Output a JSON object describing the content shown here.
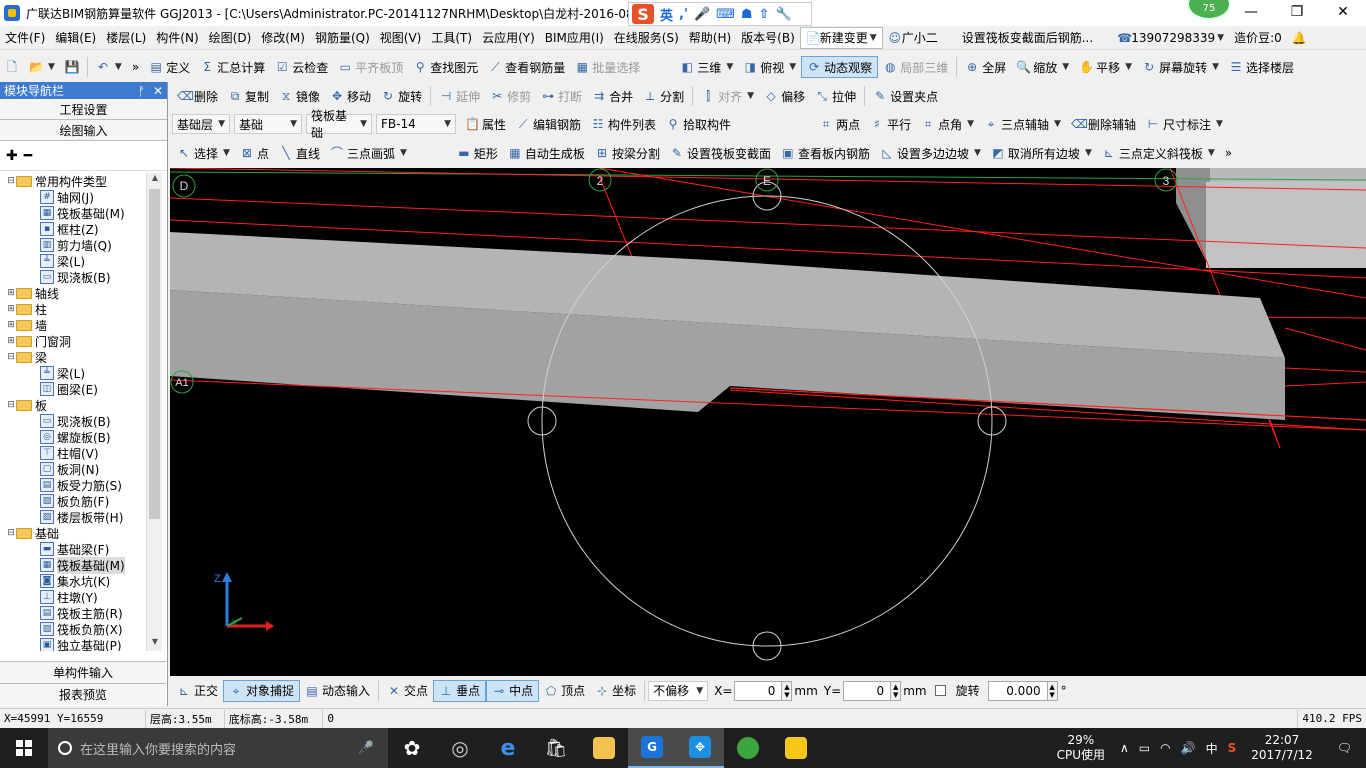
{
  "window": {
    "title": "广联达BIM钢筋算量软件 GGJ2013 - [C:\\Users\\Administrator.PC-20141127NRHM\\Desktop\\白龙村-2016-08-",
    "ime_label": "英",
    "badge": "75",
    "minimize": "—",
    "restore": "❐",
    "close": "✕"
  },
  "menu": {
    "items": [
      "文件(F)",
      "编辑(E)",
      "楼层(L)",
      "构件(N)",
      "绘图(D)",
      "修改(M)",
      "钢筋量(Q)",
      "视图(V)",
      "工具(T)",
      "云应用(Y)",
      "BIM应用(I)",
      "在线服务(S)",
      "帮助(H)",
      "版本号(B)"
    ],
    "new_change": "新建变更",
    "assistant": "广小二",
    "hint": "设置筏板变截面后钢筋...",
    "phone": "13907298339",
    "cost_beans": "造价豆:0"
  },
  "toolbar1": {
    "define": "定义",
    "summary": "汇总计算",
    "cloud_check": "云检查",
    "flush_top": "平齐板顶",
    "find_element": "查找图元",
    "view_rebar": "查看钢筋量",
    "batch_select": "批量选择",
    "view3d": "三维",
    "top_view": "俯视",
    "dynamic_observe": "动态观察",
    "local3d": "局部三维",
    "fullscreen": "全屏",
    "zoom": "缩放",
    "pan": "平移",
    "screen_rotate": "屏幕旋转",
    "select_floor": "选择楼层"
  },
  "toolbar2": {
    "delete": "删除",
    "copy": "复制",
    "mirror": "镜像",
    "move": "移动",
    "rotate": "旋转",
    "extend": "延伸",
    "trim": "修剪",
    "break": "打断",
    "merge": "合并",
    "split": "分割",
    "align": "对齐",
    "offset": "偏移",
    "stretch": "拉伸",
    "set_grip": "设置夹点"
  },
  "toolbar3": {
    "floor": "基础层",
    "category": "基础",
    "type": "筏板基础",
    "element": "FB-14",
    "attributes": "属性",
    "edit_rebar": "编辑钢筋",
    "element_list": "构件列表",
    "pick_element": "拾取构件",
    "two_points": "两点",
    "parallel": "平行",
    "point_angle": "点角",
    "three_point_aux": "三点辅轴",
    "delete_aux": "删除辅轴",
    "dimension": "尺寸标注"
  },
  "toolbar4": {
    "select": "选择",
    "point": "点",
    "line": "直线",
    "three_point_arc": "三点画弧",
    "rectangle": "矩形",
    "auto_generate": "自动生成板",
    "split_by_beam": "按梁分割",
    "set_variable_section": "设置筏板变截面",
    "view_inner_rebar": "查看板内钢筋",
    "set_multi_slope": "设置多边边坡",
    "cancel_all_slope": "取消所有边坡",
    "three_point_slope": "三点定义斜筏板"
  },
  "nav": {
    "title": "模块导航栏",
    "pin": "ᚡ",
    "close": "✕",
    "project_settings": "工程设置",
    "drawing_input": "绘图输入",
    "single_input": "单构件输入",
    "report_preview": "报表预览",
    "tree": [
      {
        "level": 0,
        "exp": "⊟",
        "kind": "folder",
        "label": "常用构件类型"
      },
      {
        "level": 1,
        "kind": "leaf",
        "icon": "#",
        "label": "轴网(J)"
      },
      {
        "level": 1,
        "kind": "leaf",
        "icon": "▦",
        "label": "筏板基础(M)"
      },
      {
        "level": 1,
        "kind": "leaf",
        "icon": "▪",
        "label": "框柱(Z)"
      },
      {
        "level": 1,
        "kind": "leaf",
        "icon": "▥",
        "label": "剪力墙(Q)"
      },
      {
        "level": 1,
        "kind": "leaf",
        "icon": "╧",
        "label": "梁(L)"
      },
      {
        "level": 1,
        "kind": "leaf",
        "icon": "▭",
        "label": "现浇板(B)"
      },
      {
        "level": 0,
        "exp": "⊞",
        "kind": "folder",
        "label": "轴线"
      },
      {
        "level": 0,
        "exp": "⊞",
        "kind": "folder",
        "label": "柱"
      },
      {
        "level": 0,
        "exp": "⊞",
        "kind": "folder",
        "label": "墙"
      },
      {
        "level": 0,
        "exp": "⊞",
        "kind": "folder",
        "label": "门窗洞"
      },
      {
        "level": 0,
        "exp": "⊟",
        "kind": "folder",
        "label": "梁"
      },
      {
        "level": 1,
        "kind": "leaf",
        "icon": "╧",
        "label": "梁(L)"
      },
      {
        "level": 1,
        "kind": "leaf",
        "icon": "◫",
        "label": "圈梁(E)"
      },
      {
        "level": 0,
        "exp": "⊟",
        "kind": "folder",
        "label": "板"
      },
      {
        "level": 1,
        "kind": "leaf",
        "icon": "▭",
        "label": "现浇板(B)"
      },
      {
        "level": 1,
        "kind": "leaf",
        "icon": "◎",
        "label": "螺旋板(B)"
      },
      {
        "level": 1,
        "kind": "leaf",
        "icon": "⊤",
        "label": "柱帽(V)"
      },
      {
        "level": 1,
        "kind": "leaf",
        "icon": "▢",
        "label": "板洞(N)"
      },
      {
        "level": 1,
        "kind": "leaf",
        "icon": "▤",
        "label": "板受力筋(S)"
      },
      {
        "level": 1,
        "kind": "leaf",
        "icon": "▧",
        "label": "板负筋(F)"
      },
      {
        "level": 1,
        "kind": "leaf",
        "icon": "▨",
        "label": "楼层板带(H)"
      },
      {
        "level": 0,
        "exp": "⊟",
        "kind": "folder",
        "label": "基础"
      },
      {
        "level": 1,
        "kind": "leaf",
        "icon": "▬",
        "label": "基础梁(F)"
      },
      {
        "level": 1,
        "kind": "leaf",
        "icon": "▦",
        "label": "筏板基础(M)",
        "selected": true
      },
      {
        "level": 1,
        "kind": "leaf",
        "icon": "◙",
        "label": "集水坑(K)"
      },
      {
        "level": 1,
        "kind": "leaf",
        "icon": "⊥",
        "label": "柱墩(Y)"
      },
      {
        "level": 1,
        "kind": "leaf",
        "icon": "▤",
        "label": "筏板主筋(R)"
      },
      {
        "level": 1,
        "kind": "leaf",
        "icon": "▧",
        "label": "筏板负筋(X)"
      },
      {
        "level": 1,
        "kind": "leaf",
        "icon": "▣",
        "label": "独立基础(P)"
      }
    ]
  },
  "viewport": {
    "axis_labels": [
      "D",
      "2",
      "E",
      "3",
      "A1"
    ],
    "axis_z": "Z",
    "axis_y": "Y",
    "colors": {
      "background": "#000000",
      "axis_line": "#ff2020",
      "grid_green": "#2ea043",
      "slab_top": "#b4b4b4",
      "slab_front": "#a2a2a2"
    }
  },
  "snapbar": {
    "ortho": "正交",
    "object_snap": "对象捕捉",
    "dynamic_input": "动态输入",
    "intersection": "交点",
    "perpendicular": "垂点",
    "midpoint": "中点",
    "vertex": "顶点",
    "coordinate": "坐标",
    "offset_mode": "不偏移",
    "x_label": "X=",
    "x_value": "0",
    "y_label": "Y=",
    "y_value": "0",
    "unit": "mm",
    "rotate_label": "旋转",
    "rotate_value": "0.000",
    "degree": "°"
  },
  "coordbar": {
    "xy": "X=45991 Y=16559",
    "floor_height": "层高:3.55m",
    "bottom_elev": "底标高:-3.58m",
    "zero": "0",
    "fps": "410.2 FPS"
  },
  "taskbar": {
    "search_placeholder": "在这里输入你要搜索的内容",
    "cpu_percent": "29%",
    "cpu_label": "CPU使用",
    "ime": "中",
    "time": "22:07",
    "date": "2017/7/12"
  }
}
